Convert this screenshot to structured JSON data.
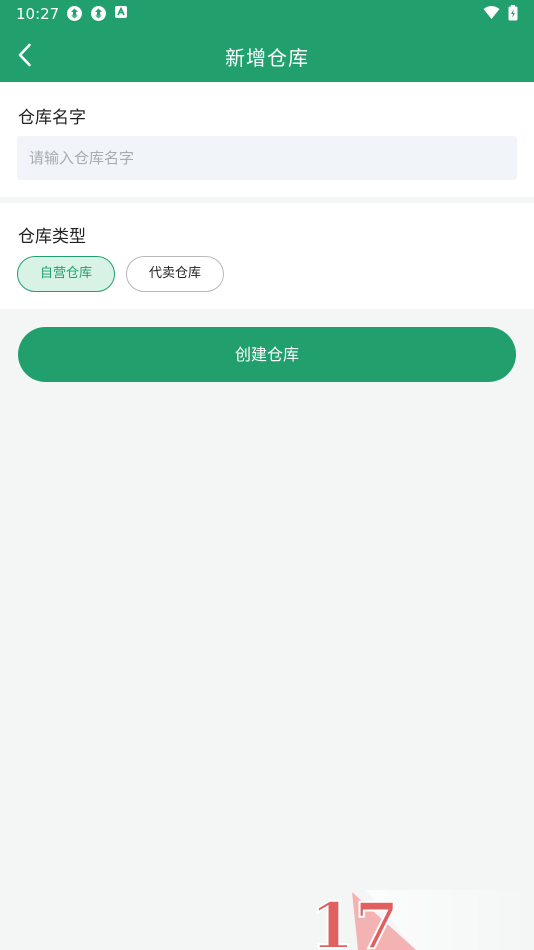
{
  "status": {
    "time": "10:27"
  },
  "appbar": {
    "title": "新增仓库"
  },
  "form": {
    "name_label": "仓库名字",
    "name_placeholder": "请输入仓库名字",
    "type_label": "仓库类型",
    "types": [
      "自营仓库",
      "代卖仓库"
    ],
    "selected_type": "自营仓库"
  },
  "actions": {
    "create_label": "创建仓库"
  },
  "watermark": {
    "text": "17"
  },
  "colors": {
    "accent": "#21a06e",
    "background": "#f4f5f5",
    "input_bg": "#f1f4f9"
  },
  "icons": [
    "sync-icon",
    "sync-icon",
    "android-icon",
    "wifi-icon",
    "battery-icon",
    "back-arrow-icon"
  ]
}
